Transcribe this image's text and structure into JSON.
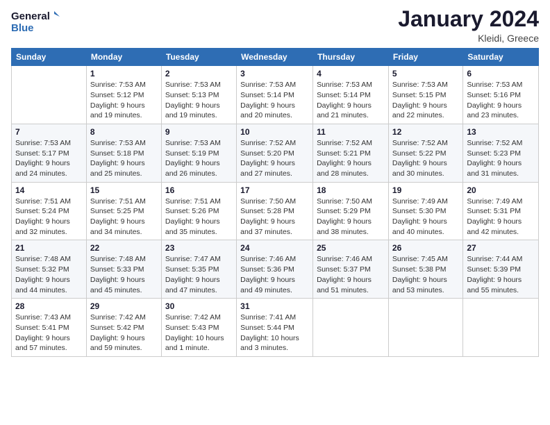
{
  "logo": {
    "line1": "General",
    "line2": "Blue"
  },
  "title": "January 2024",
  "subtitle": "Kleidi, Greece",
  "header_days": [
    "Sunday",
    "Monday",
    "Tuesday",
    "Wednesday",
    "Thursday",
    "Friday",
    "Saturday"
  ],
  "weeks": [
    [
      {
        "day": "",
        "info": ""
      },
      {
        "day": "1",
        "info": "Sunrise: 7:53 AM\nSunset: 5:12 PM\nDaylight: 9 hours\nand 19 minutes."
      },
      {
        "day": "2",
        "info": "Sunrise: 7:53 AM\nSunset: 5:13 PM\nDaylight: 9 hours\nand 19 minutes."
      },
      {
        "day": "3",
        "info": "Sunrise: 7:53 AM\nSunset: 5:14 PM\nDaylight: 9 hours\nand 20 minutes."
      },
      {
        "day": "4",
        "info": "Sunrise: 7:53 AM\nSunset: 5:14 PM\nDaylight: 9 hours\nand 21 minutes."
      },
      {
        "day": "5",
        "info": "Sunrise: 7:53 AM\nSunset: 5:15 PM\nDaylight: 9 hours\nand 22 minutes."
      },
      {
        "day": "6",
        "info": "Sunrise: 7:53 AM\nSunset: 5:16 PM\nDaylight: 9 hours\nand 23 minutes."
      }
    ],
    [
      {
        "day": "7",
        "info": "Sunrise: 7:53 AM\nSunset: 5:17 PM\nDaylight: 9 hours\nand 24 minutes."
      },
      {
        "day": "8",
        "info": "Sunrise: 7:53 AM\nSunset: 5:18 PM\nDaylight: 9 hours\nand 25 minutes."
      },
      {
        "day": "9",
        "info": "Sunrise: 7:53 AM\nSunset: 5:19 PM\nDaylight: 9 hours\nand 26 minutes."
      },
      {
        "day": "10",
        "info": "Sunrise: 7:52 AM\nSunset: 5:20 PM\nDaylight: 9 hours\nand 27 minutes."
      },
      {
        "day": "11",
        "info": "Sunrise: 7:52 AM\nSunset: 5:21 PM\nDaylight: 9 hours\nand 28 minutes."
      },
      {
        "day": "12",
        "info": "Sunrise: 7:52 AM\nSunset: 5:22 PM\nDaylight: 9 hours\nand 30 minutes."
      },
      {
        "day": "13",
        "info": "Sunrise: 7:52 AM\nSunset: 5:23 PM\nDaylight: 9 hours\nand 31 minutes."
      }
    ],
    [
      {
        "day": "14",
        "info": "Sunrise: 7:51 AM\nSunset: 5:24 PM\nDaylight: 9 hours\nand 32 minutes."
      },
      {
        "day": "15",
        "info": "Sunrise: 7:51 AM\nSunset: 5:25 PM\nDaylight: 9 hours\nand 34 minutes."
      },
      {
        "day": "16",
        "info": "Sunrise: 7:51 AM\nSunset: 5:26 PM\nDaylight: 9 hours\nand 35 minutes."
      },
      {
        "day": "17",
        "info": "Sunrise: 7:50 AM\nSunset: 5:28 PM\nDaylight: 9 hours\nand 37 minutes."
      },
      {
        "day": "18",
        "info": "Sunrise: 7:50 AM\nSunset: 5:29 PM\nDaylight: 9 hours\nand 38 minutes."
      },
      {
        "day": "19",
        "info": "Sunrise: 7:49 AM\nSunset: 5:30 PM\nDaylight: 9 hours\nand 40 minutes."
      },
      {
        "day": "20",
        "info": "Sunrise: 7:49 AM\nSunset: 5:31 PM\nDaylight: 9 hours\nand 42 minutes."
      }
    ],
    [
      {
        "day": "21",
        "info": "Sunrise: 7:48 AM\nSunset: 5:32 PM\nDaylight: 9 hours\nand 44 minutes."
      },
      {
        "day": "22",
        "info": "Sunrise: 7:48 AM\nSunset: 5:33 PM\nDaylight: 9 hours\nand 45 minutes."
      },
      {
        "day": "23",
        "info": "Sunrise: 7:47 AM\nSunset: 5:35 PM\nDaylight: 9 hours\nand 47 minutes."
      },
      {
        "day": "24",
        "info": "Sunrise: 7:46 AM\nSunset: 5:36 PM\nDaylight: 9 hours\nand 49 minutes."
      },
      {
        "day": "25",
        "info": "Sunrise: 7:46 AM\nSunset: 5:37 PM\nDaylight: 9 hours\nand 51 minutes."
      },
      {
        "day": "26",
        "info": "Sunrise: 7:45 AM\nSunset: 5:38 PM\nDaylight: 9 hours\nand 53 minutes."
      },
      {
        "day": "27",
        "info": "Sunrise: 7:44 AM\nSunset: 5:39 PM\nDaylight: 9 hours\nand 55 minutes."
      }
    ],
    [
      {
        "day": "28",
        "info": "Sunrise: 7:43 AM\nSunset: 5:41 PM\nDaylight: 9 hours\nand 57 minutes."
      },
      {
        "day": "29",
        "info": "Sunrise: 7:42 AM\nSunset: 5:42 PM\nDaylight: 9 hours\nand 59 minutes."
      },
      {
        "day": "30",
        "info": "Sunrise: 7:42 AM\nSunset: 5:43 PM\nDaylight: 10 hours\nand 1 minute."
      },
      {
        "day": "31",
        "info": "Sunrise: 7:41 AM\nSunset: 5:44 PM\nDaylight: 10 hours\nand 3 minutes."
      },
      {
        "day": "",
        "info": ""
      },
      {
        "day": "",
        "info": ""
      },
      {
        "day": "",
        "info": ""
      }
    ]
  ]
}
